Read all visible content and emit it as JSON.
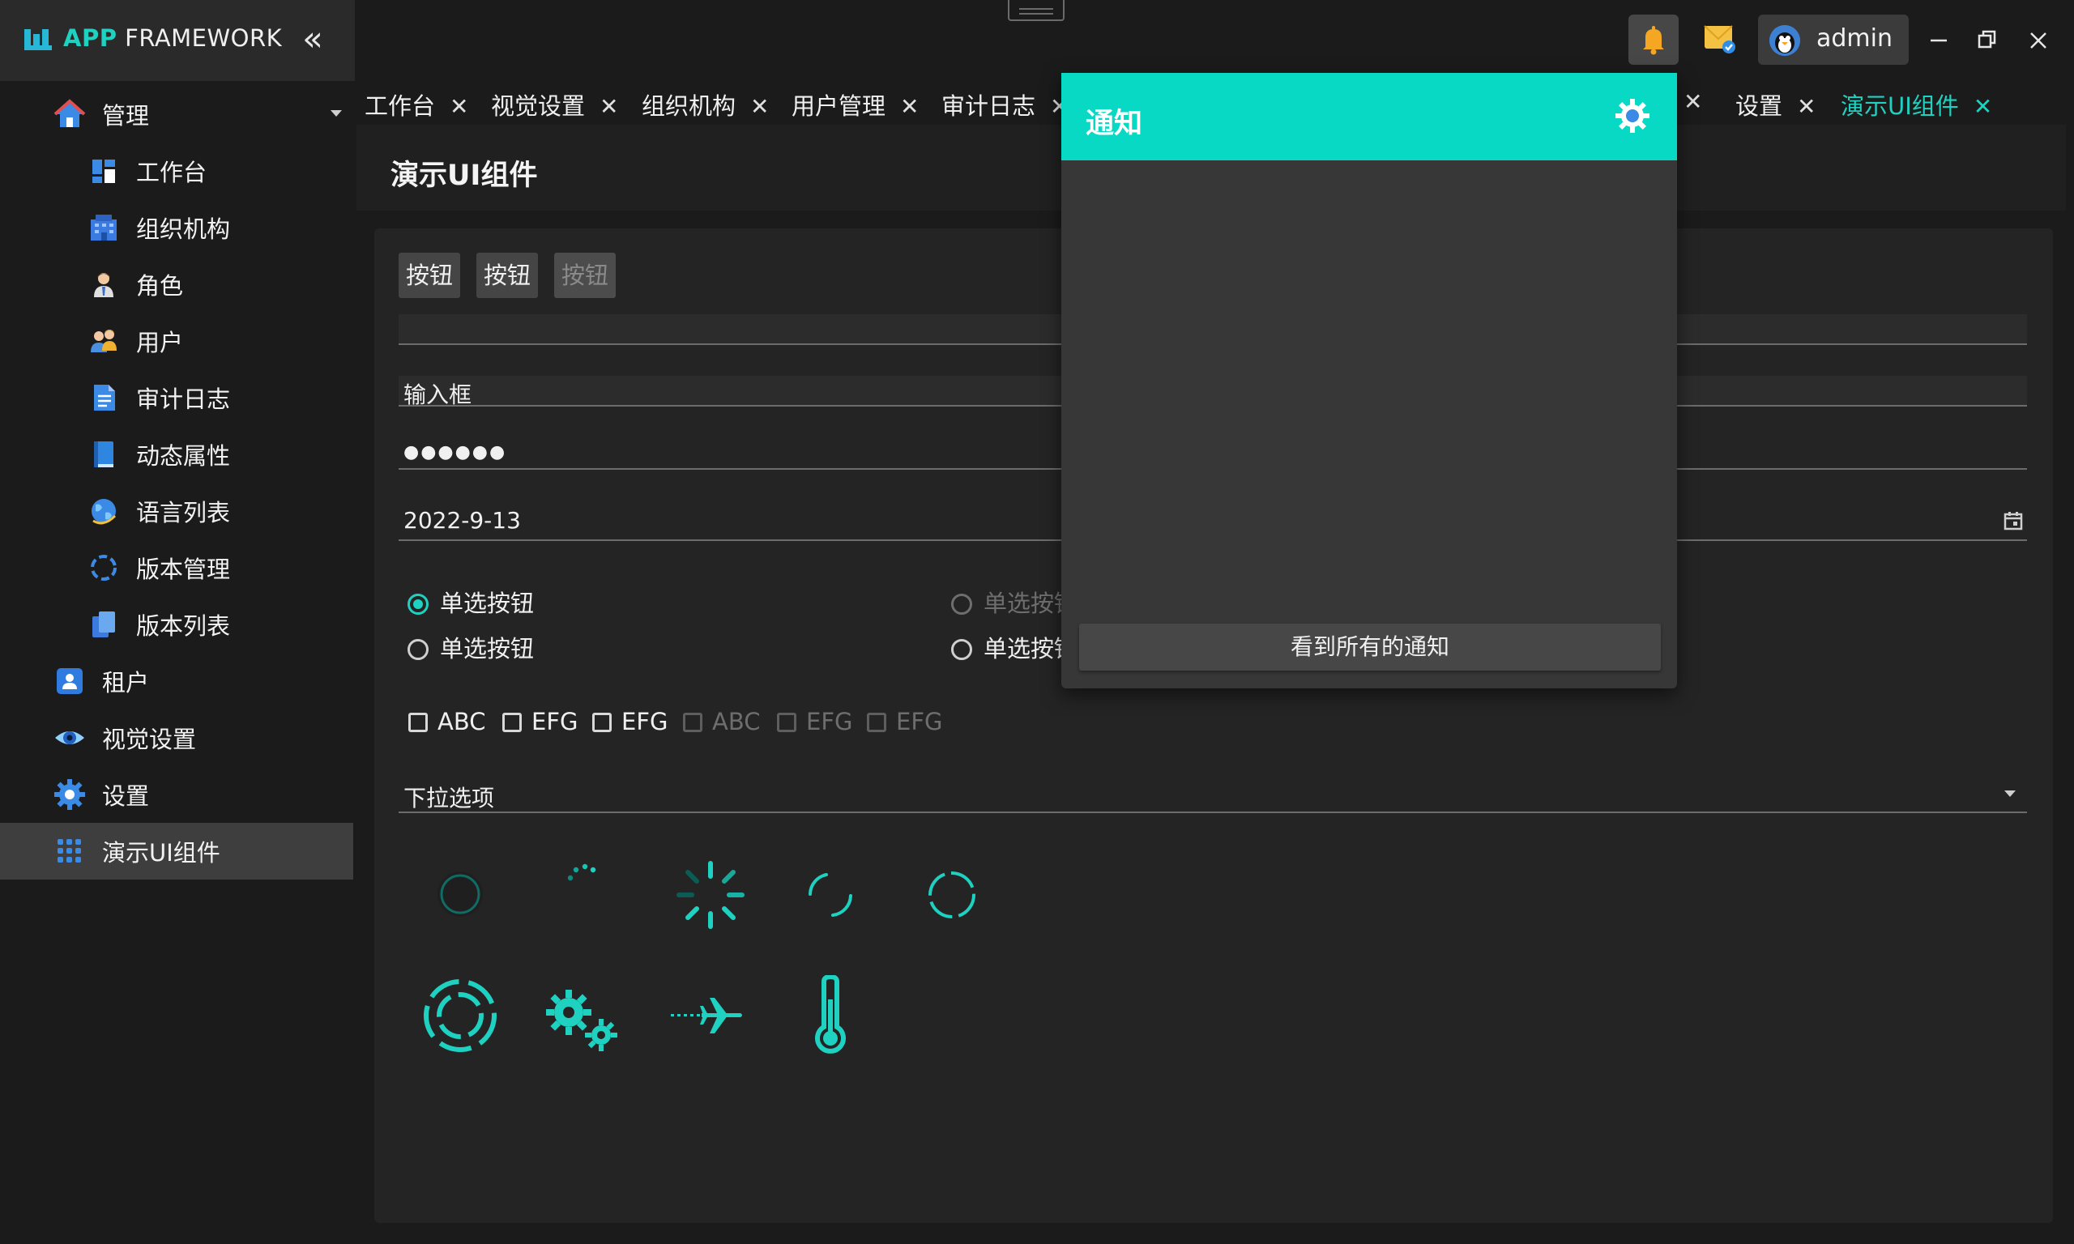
{
  "app": {
    "brand_accent": "APP",
    "brand_rest": " FRAMEWORK",
    "accent_color": "#1fd1c0"
  },
  "header": {
    "user_name": "admin"
  },
  "sidebar": {
    "items": [
      {
        "label": "管理",
        "icon": "home-icon",
        "level": 1,
        "expandable": true
      },
      {
        "label": "工作台",
        "icon": "dashboard-icon",
        "level": 2
      },
      {
        "label": "组织机构",
        "icon": "building-icon",
        "level": 2
      },
      {
        "label": "角色",
        "icon": "role-person-icon",
        "level": 2
      },
      {
        "label": "用户",
        "icon": "users-icon",
        "level": 2
      },
      {
        "label": "审计日志",
        "icon": "document-icon",
        "level": 2
      },
      {
        "label": "动态属性",
        "icon": "book-icon",
        "level": 2
      },
      {
        "label": "语言列表",
        "icon": "globe-icon",
        "level": 2
      },
      {
        "label": "版本管理",
        "icon": "refresh-icon",
        "level": 2
      },
      {
        "label": "版本列表",
        "icon": "copy-icon",
        "level": 2
      },
      {
        "label": "租户",
        "icon": "tenant-icon",
        "level": 1
      },
      {
        "label": "视觉设置",
        "icon": "eye-icon",
        "level": 1
      },
      {
        "label": "设置",
        "icon": "gear-icon",
        "level": 1
      },
      {
        "label": "演示UI组件",
        "icon": "grid-icon",
        "level": 1,
        "active": true
      }
    ]
  },
  "tabs": [
    {
      "label": "工作台"
    },
    {
      "label": "视觉设置"
    },
    {
      "label": "组织机构"
    },
    {
      "label": "用户管理"
    },
    {
      "label": "审计日志"
    },
    {
      "label": ""
    },
    {
      "label": "设置"
    },
    {
      "label": "演示UI组件",
      "active": true
    }
  ],
  "page": {
    "title": "演示UI组件"
  },
  "demo": {
    "buttons": [
      "按钮",
      "按钮",
      "按钮"
    ],
    "text_input": "",
    "labeled_input": "输入框",
    "password_mask": "●●●●●●",
    "date_value": "2022-9-13",
    "radios": [
      {
        "label": "单选按钮",
        "checked": true,
        "disabled": false
      },
      {
        "label": "单选按钮",
        "checked": false,
        "disabled": false
      },
      {
        "label": "单选按钮",
        "checked": false,
        "disabled": true
      },
      {
        "label": "单选按钮",
        "checked": false,
        "disabled": false
      }
    ],
    "checkboxes": [
      {
        "label": "ABC",
        "disabled": false
      },
      {
        "label": "EFG",
        "disabled": false
      },
      {
        "label": "EFG",
        "disabled": false
      },
      {
        "label": "ABC",
        "disabled": true
      },
      {
        "label": "EFG",
        "disabled": true
      },
      {
        "label": "EFG",
        "disabled": true
      }
    ],
    "dropdown_label": "下拉选项"
  },
  "notification": {
    "title": "通知",
    "view_all": "看到所有的通知",
    "header_color": "#08d9c5"
  }
}
